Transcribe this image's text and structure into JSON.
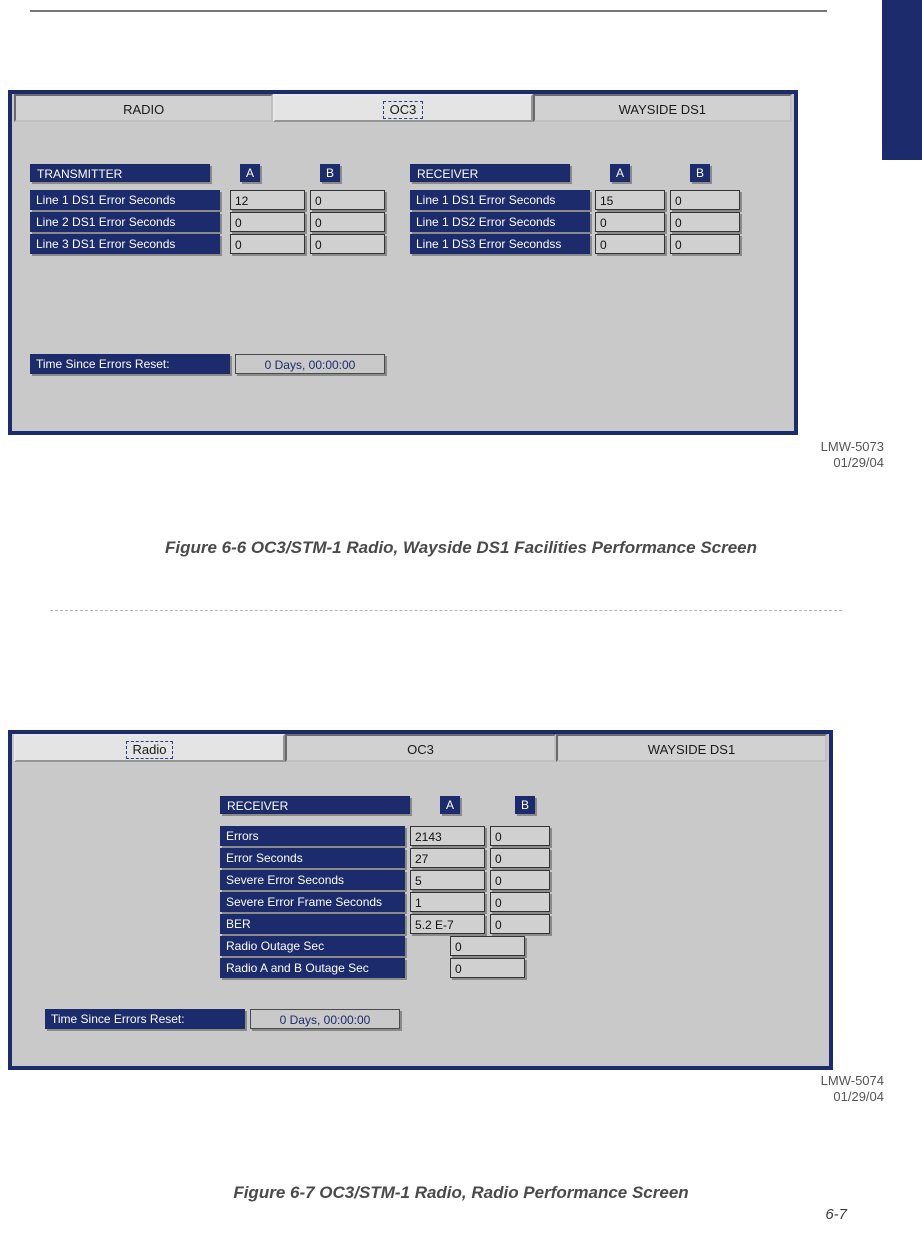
{
  "fig1": {
    "tabs": {
      "radio": "RADIO",
      "oc3": "OC3",
      "wayside": "WAYSIDE DS1"
    },
    "tx": {
      "title": "TRANSMITTER",
      "colA": "A",
      "colB": "B",
      "rows": [
        {
          "label": "Line 1 DS1 Error Seconds",
          "a": "12",
          "b": "0"
        },
        {
          "label": "Line 2 DS1 Error Seconds",
          "a": "0",
          "b": "0"
        },
        {
          "label": "Line 3 DS1 Error Seconds",
          "a": "0",
          "b": "0"
        }
      ]
    },
    "rx": {
      "title": "RECEIVER",
      "colA": "A",
      "colB": "B",
      "rows": [
        {
          "label": "Line 1 DS1 Error Seconds",
          "a": "15",
          "b": "0"
        },
        {
          "label": "Line 1 DS2 Error Seconds",
          "a": "0",
          "b": "0"
        },
        {
          "label": "Line 1 DS3 Error Secondss",
          "a": "0",
          "b": "0"
        }
      ]
    },
    "time": {
      "label": "Time Since Errors Reset:",
      "value": "0 Days, 00:00:00"
    },
    "meta": {
      "id": "LMW-5073",
      "date": "01/29/04"
    },
    "caption": "Figure 6-6  OC3/STM-1 Radio, Wayside DS1 Facilities Performance Screen"
  },
  "fig2": {
    "tabs": {
      "radio": "Radio",
      "oc3": "OC3",
      "wayside": "WAYSIDE DS1"
    },
    "rx": {
      "title": "RECEIVER",
      "colA": "A",
      "colB": "B",
      "rows": [
        {
          "label": "Errors",
          "a": "2143",
          "b": "0"
        },
        {
          "label": "Error Seconds",
          "a": "27",
          "b": "0"
        },
        {
          "label": "Severe Error Seconds",
          "a": "5",
          "b": "0"
        },
        {
          "label": "Severe Error Frame Seconds",
          "a": "1",
          "b": "0"
        },
        {
          "label": "BER",
          "a": "5.2 E-7",
          "b": "0"
        }
      ],
      "singles": [
        {
          "label": "Radio Outage Sec",
          "v": "0"
        },
        {
          "label": "Radio A and B Outage Sec",
          "v": "0"
        }
      ]
    },
    "time": {
      "label": "Time Since Errors Reset:",
      "value": "0 Days, 00:00:00"
    },
    "meta": {
      "id": "LMW-5074",
      "date": "01/29/04"
    },
    "caption": "Figure 6-7  OC3/STM-1 Radio, Radio Performance Screen"
  },
  "page_number": "6-7"
}
